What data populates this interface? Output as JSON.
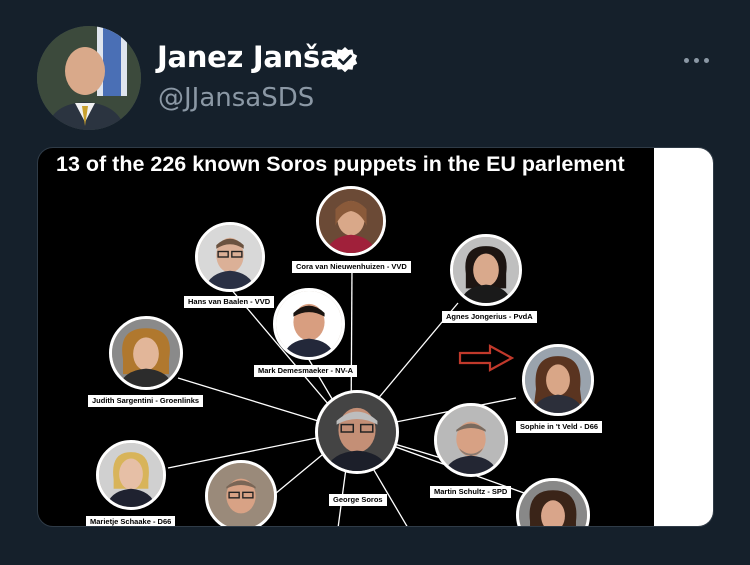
{
  "tweet": {
    "display_name": "Janez Janša",
    "handle": "@JJansaSDS",
    "verified_icon": "verified-badge-icon",
    "more_icon": "more-options-icon"
  },
  "media": {
    "title": "13 of the 226 known Soros puppets in the EU parlement",
    "people": {
      "cora": "Cora van Nieuwenhuizen - VVD",
      "hans": "Hans van Baalen - VVD",
      "agnes": "Agnes Jongerius - PvdA",
      "mark": "Mark Demesmaeker - NV-A",
      "judith": "Judith Sargentini - Groenlinks",
      "sophie": "Sophie in 't Veld - D66",
      "george": "George Soros",
      "martin": "Martin Schultz - SPD",
      "marietje": "Marietje Schaake - D66"
    }
  },
  "colors": {
    "background": "#15202b",
    "handle": "#8b98a5",
    "verified_badge": "#ffffff",
    "arrow": "#c0392b"
  }
}
